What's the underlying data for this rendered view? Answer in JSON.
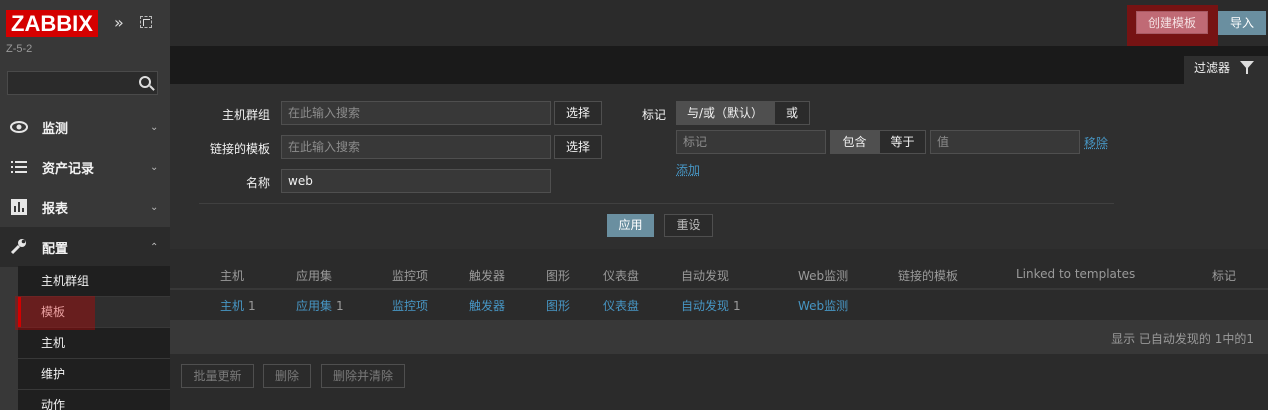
{
  "sidebar": {
    "logo": "ZABBIX",
    "server_name": "Z-5-2",
    "search_placeholder": "",
    "menu": [
      {
        "label": "监测",
        "icon": "eye-icon"
      },
      {
        "label": "资产记录",
        "icon": "list-icon"
      },
      {
        "label": "报表",
        "icon": "bar-chart-icon"
      },
      {
        "label": "配置",
        "icon": "wrench-icon"
      }
    ],
    "submenu": [
      "主机群组",
      "模板",
      "主机",
      "维护",
      "动作"
    ]
  },
  "header": {
    "create_label": "创建模板",
    "import_label": "导入"
  },
  "filter": {
    "tab_label": "过滤器",
    "host_group_label": "主机群组",
    "host_group_placeholder": "在此输入搜索",
    "linked_templates_label": "链接的模板",
    "linked_templates_placeholder": "在此输入搜索",
    "name_label": "名称",
    "name_value": "web",
    "select_label": "选择",
    "tags_label": "标记",
    "tags_and_or": "与/或（默认）",
    "tags_or": "或",
    "tag_placeholder": "标记",
    "contains": "包含",
    "equals": "等于",
    "value_placeholder": "值",
    "remove": "移除",
    "add": "添加",
    "apply": "应用",
    "reset": "重设"
  },
  "table": {
    "headers": [
      "主机",
      "应用集",
      "监控项",
      "触发器",
      "图形",
      "仪表盘",
      "自动发现",
      "Web监测",
      "链接的模板",
      "Linked to templates",
      "标记"
    ],
    "row": {
      "hosts": "主机",
      "hosts_count": "1",
      "applications": "应用集",
      "applications_count": "1",
      "items": "监控项",
      "triggers": "触发器",
      "graphs": "图形",
      "dashboards": "仪表盘",
      "discovery": "自动发现",
      "discovery_count": "1",
      "web": "Web监测"
    },
    "footer": "显示 已自动发现的 1中的1"
  },
  "mass_actions": {
    "mass_update": "批量更新",
    "delete": "删除",
    "delete_clear": "删除并清除"
  },
  "colors": {
    "brand": "#d40000",
    "link": "#4796c4",
    "primary_button": "#6a8fa0"
  }
}
